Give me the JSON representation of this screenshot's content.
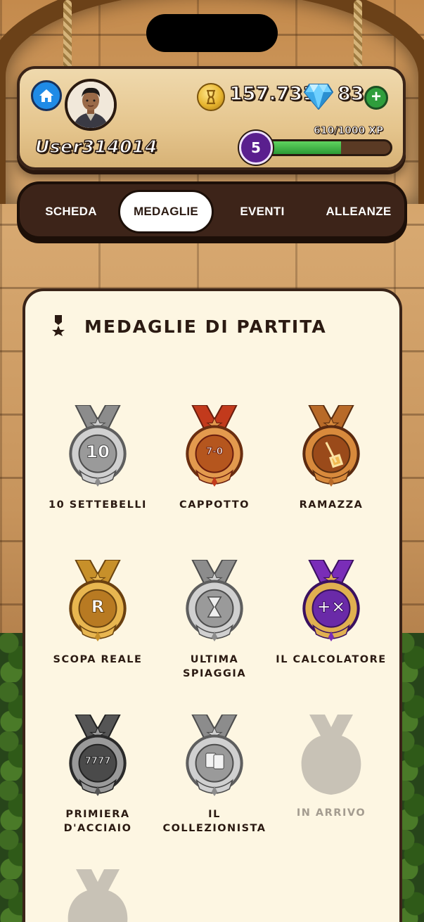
{
  "profile": {
    "username": "User314014",
    "coins": "157.731",
    "gems": "83",
    "xp": "610/1000 XP",
    "xp_fraction": 0.61,
    "level": "5"
  },
  "tabs": [
    {
      "label": "SCHEDA",
      "active": false
    },
    {
      "label": "MEDAGLIE",
      "active": true
    },
    {
      "label": "EVENTI",
      "active": false
    },
    {
      "label": "ALLEANZE",
      "active": false
    }
  ],
  "section": {
    "title": "MEDAGLIE DI PARTITA",
    "icon": "medal-ribbon-icon"
  },
  "medals": [
    {
      "label": "10 SETTEBELLI",
      "tier": "silver",
      "emblem": "10",
      "locked": false
    },
    {
      "label": "CAPPOTTO",
      "tier": "bronze-red",
      "emblem": "7-0",
      "locked": false
    },
    {
      "label": "RAMAZZA",
      "tier": "bronze",
      "emblem": "broom",
      "locked": false
    },
    {
      "label": "SCOPA REALE",
      "tier": "gold",
      "emblem": "R",
      "locked": false
    },
    {
      "label": "ULTIMA SPIAGGIA",
      "tier": "silver",
      "emblem": "hourglass",
      "locked": false
    },
    {
      "label": "IL CALCOLATORE",
      "tier": "purple",
      "emblem": "+×",
      "locked": false
    },
    {
      "label": "PRIMIERA D'ACCIAIO",
      "tier": "steel",
      "emblem": "7777",
      "locked": false
    },
    {
      "label": "IL COLLEZIONISTA",
      "tier": "silver",
      "emblem": "cards",
      "locked": false
    },
    {
      "label": "IN ARRIVO",
      "tier": "locked",
      "emblem": "",
      "locked": true
    },
    {
      "label": "",
      "tier": "locked",
      "emblem": "",
      "locked": true
    }
  ],
  "colors": {
    "card_bg": "#fdf6e2",
    "tab_bar": "#3d2419",
    "home_button": "#1f8be6",
    "plus_button": "#2f9e3c",
    "level_badge": "#5a1f8e",
    "xp_fill": "#2c9a35"
  }
}
